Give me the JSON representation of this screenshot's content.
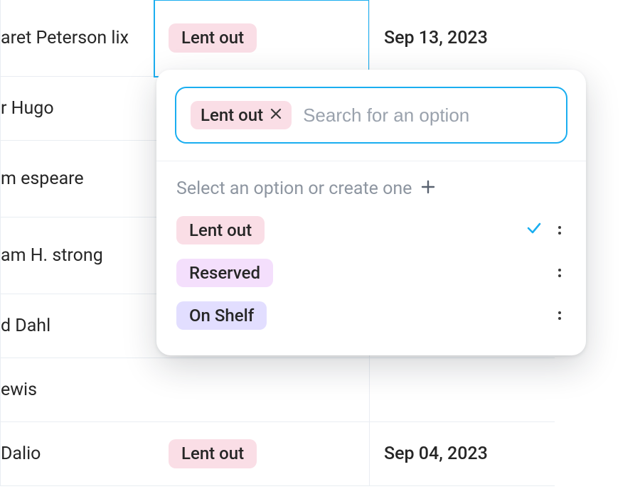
{
  "rows": [
    {
      "name": "aret Peterson lix",
      "status": "Lent out",
      "date": "Sep 13, 2023",
      "h": "h108"
    },
    {
      "name": "r Hugo",
      "status": "",
      "date": "",
      "h": "h90"
    },
    {
      "name": "m espeare",
      "status": "",
      "date": "",
      "h": "h108"
    },
    {
      "name": "am H. strong",
      "status": "",
      "date": "",
      "h": "h108"
    },
    {
      "name": "d Dahl",
      "status": "",
      "date": "",
      "h": "h90"
    },
    {
      "name": "ewis",
      "status": "",
      "date": "",
      "h": "h90"
    },
    {
      "name": "Dalio",
      "status": "Lent out",
      "date": "Sep 04, 2023",
      "h": "h90"
    }
  ],
  "picker": {
    "selected_chip": "Lent out",
    "placeholder": "Search for an option",
    "hint": "Select an option or create one",
    "options": [
      {
        "label": "Lent out",
        "color": "pink",
        "checked": true
      },
      {
        "label": "Reserved",
        "color": "purple",
        "checked": false
      },
      {
        "label": "On Shelf",
        "color": "violet",
        "checked": false
      }
    ]
  }
}
